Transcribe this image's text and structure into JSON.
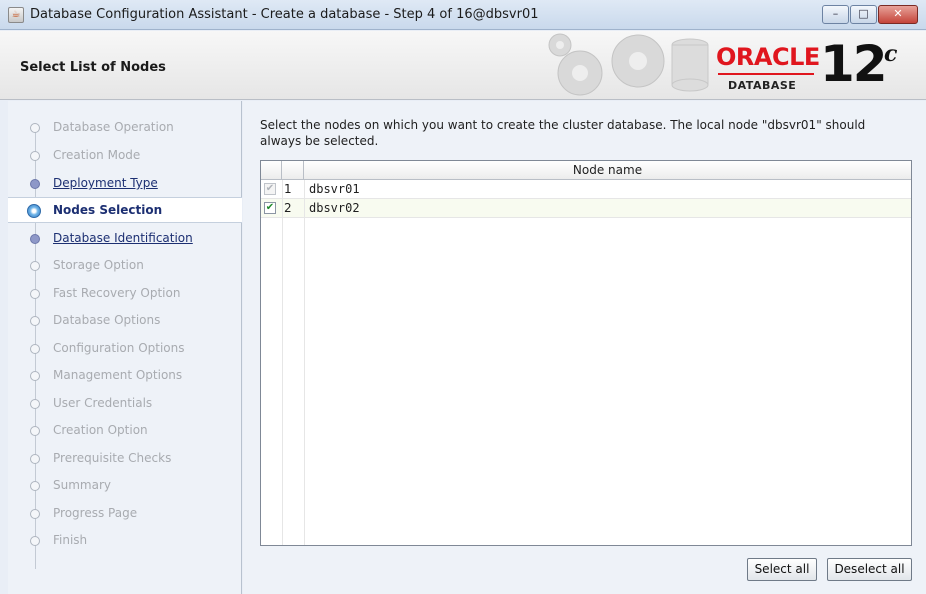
{
  "window": {
    "title": "Database Configuration Assistant - Create a database - Step 4 of 16@dbsvr01",
    "minimize": "–",
    "maximize": "□",
    "close": "✕"
  },
  "header": {
    "page_title": "Select List of Nodes",
    "logo": {
      "brand": "ORACLE",
      "product": "DATABASE",
      "version": "12",
      "version_suffix": "c"
    }
  },
  "steps": [
    {
      "label": "Database Operation",
      "state": "disabled"
    },
    {
      "label": "Creation Mode",
      "state": "disabled"
    },
    {
      "label": "Deployment Type",
      "state": "link"
    },
    {
      "label": "Nodes Selection",
      "state": "current"
    },
    {
      "label": "Database Identification",
      "state": "link"
    },
    {
      "label": "Storage Option",
      "state": "disabled"
    },
    {
      "label": "Fast Recovery Option",
      "state": "disabled"
    },
    {
      "label": "Database Options",
      "state": "disabled"
    },
    {
      "label": "Configuration Options",
      "state": "disabled"
    },
    {
      "label": "Management Options",
      "state": "disabled"
    },
    {
      "label": "User Credentials",
      "state": "disabled"
    },
    {
      "label": "Creation Option",
      "state": "disabled"
    },
    {
      "label": "Prerequisite Checks",
      "state": "disabled"
    },
    {
      "label": "Summary",
      "state": "disabled"
    },
    {
      "label": "Progress Page",
      "state": "disabled"
    },
    {
      "label": "Finish",
      "state": "disabled"
    }
  ],
  "main": {
    "instruction": "Select the nodes on which you want to create the cluster database. The local node \"dbsvr01\" should always be selected.",
    "table": {
      "column_header": "Node name",
      "rows": [
        {
          "num": "1",
          "name": "dbsvr01",
          "checked": true,
          "disabled": true
        },
        {
          "num": "2",
          "name": "dbsvr02",
          "checked": true,
          "disabled": false
        }
      ]
    },
    "buttons": {
      "select_all": "Select all",
      "deselect_all": "Deselect all"
    }
  }
}
